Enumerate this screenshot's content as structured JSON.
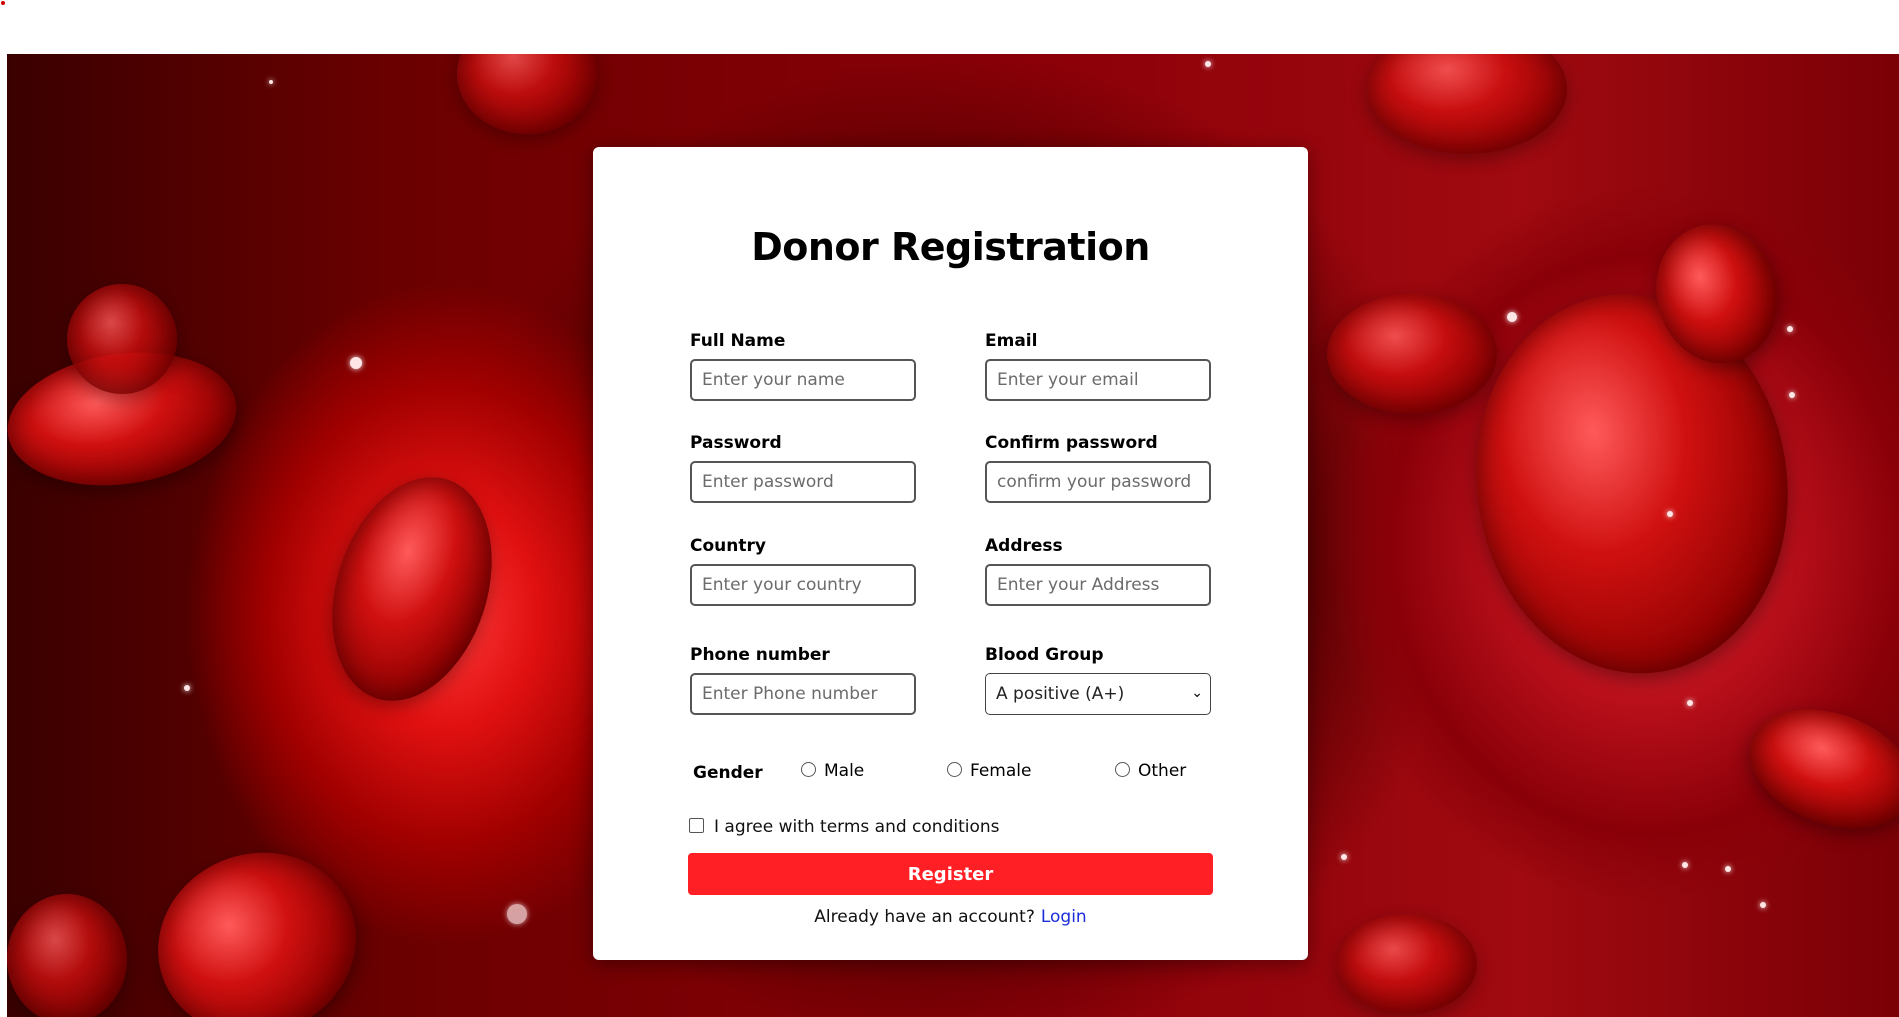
{
  "form": {
    "title": "Donor Registration",
    "full_name": {
      "label": "Full Name",
      "placeholder": "Enter your name",
      "value": ""
    },
    "email": {
      "label": "Email",
      "placeholder": "Enter your email",
      "value": ""
    },
    "password": {
      "label": "Password",
      "placeholder": "Enter password",
      "value": ""
    },
    "confirm_password": {
      "label": "Confirm password",
      "placeholder": "confirm your password",
      "value": ""
    },
    "country": {
      "label": "Country",
      "placeholder": "Enter your country",
      "value": ""
    },
    "address": {
      "label": "Address",
      "placeholder": "Enter your Address",
      "value": ""
    },
    "phone": {
      "label": "Phone number",
      "placeholder": "Enter Phone number",
      "value": ""
    },
    "blood_group": {
      "label": "Blood Group",
      "selected": "A positive (A+)"
    },
    "gender": {
      "label": "Gender",
      "options": [
        "Male",
        "Female",
        "Other"
      ]
    },
    "terms_label": "I agree with terms and conditions",
    "register_label": "Register",
    "login_prompt": "Already have an account?",
    "login_link": "Login"
  },
  "colors": {
    "accent": "#ff1f24",
    "link": "#1a2dd6",
    "background": "#8c0008"
  }
}
